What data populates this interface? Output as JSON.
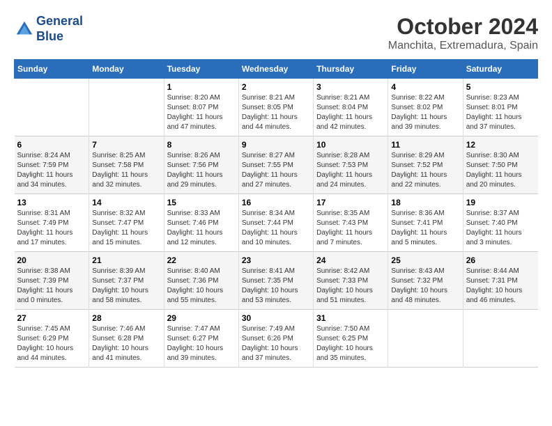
{
  "header": {
    "logo_line1": "General",
    "logo_line2": "Blue",
    "title": "October 2024",
    "subtitle": "Manchita, Extremadura, Spain"
  },
  "calendar": {
    "headers": [
      "Sunday",
      "Monday",
      "Tuesday",
      "Wednesday",
      "Thursday",
      "Friday",
      "Saturday"
    ],
    "weeks": [
      [
        {
          "day": "",
          "info": ""
        },
        {
          "day": "",
          "info": ""
        },
        {
          "day": "1",
          "info": "Sunrise: 8:20 AM\nSunset: 8:07 PM\nDaylight: 11 hours and 47 minutes."
        },
        {
          "day": "2",
          "info": "Sunrise: 8:21 AM\nSunset: 8:05 PM\nDaylight: 11 hours and 44 minutes."
        },
        {
          "day": "3",
          "info": "Sunrise: 8:21 AM\nSunset: 8:04 PM\nDaylight: 11 hours and 42 minutes."
        },
        {
          "day": "4",
          "info": "Sunrise: 8:22 AM\nSunset: 8:02 PM\nDaylight: 11 hours and 39 minutes."
        },
        {
          "day": "5",
          "info": "Sunrise: 8:23 AM\nSunset: 8:01 PM\nDaylight: 11 hours and 37 minutes."
        }
      ],
      [
        {
          "day": "6",
          "info": "Sunrise: 8:24 AM\nSunset: 7:59 PM\nDaylight: 11 hours and 34 minutes."
        },
        {
          "day": "7",
          "info": "Sunrise: 8:25 AM\nSunset: 7:58 PM\nDaylight: 11 hours and 32 minutes."
        },
        {
          "day": "8",
          "info": "Sunrise: 8:26 AM\nSunset: 7:56 PM\nDaylight: 11 hours and 29 minutes."
        },
        {
          "day": "9",
          "info": "Sunrise: 8:27 AM\nSunset: 7:55 PM\nDaylight: 11 hours and 27 minutes."
        },
        {
          "day": "10",
          "info": "Sunrise: 8:28 AM\nSunset: 7:53 PM\nDaylight: 11 hours and 24 minutes."
        },
        {
          "day": "11",
          "info": "Sunrise: 8:29 AM\nSunset: 7:52 PM\nDaylight: 11 hours and 22 minutes."
        },
        {
          "day": "12",
          "info": "Sunrise: 8:30 AM\nSunset: 7:50 PM\nDaylight: 11 hours and 20 minutes."
        }
      ],
      [
        {
          "day": "13",
          "info": "Sunrise: 8:31 AM\nSunset: 7:49 PM\nDaylight: 11 hours and 17 minutes."
        },
        {
          "day": "14",
          "info": "Sunrise: 8:32 AM\nSunset: 7:47 PM\nDaylight: 11 hours and 15 minutes."
        },
        {
          "day": "15",
          "info": "Sunrise: 8:33 AM\nSunset: 7:46 PM\nDaylight: 11 hours and 12 minutes."
        },
        {
          "day": "16",
          "info": "Sunrise: 8:34 AM\nSunset: 7:44 PM\nDaylight: 11 hours and 10 minutes."
        },
        {
          "day": "17",
          "info": "Sunrise: 8:35 AM\nSunset: 7:43 PM\nDaylight: 11 hours and 7 minutes."
        },
        {
          "day": "18",
          "info": "Sunrise: 8:36 AM\nSunset: 7:41 PM\nDaylight: 11 hours and 5 minutes."
        },
        {
          "day": "19",
          "info": "Sunrise: 8:37 AM\nSunset: 7:40 PM\nDaylight: 11 hours and 3 minutes."
        }
      ],
      [
        {
          "day": "20",
          "info": "Sunrise: 8:38 AM\nSunset: 7:39 PM\nDaylight: 11 hours and 0 minutes."
        },
        {
          "day": "21",
          "info": "Sunrise: 8:39 AM\nSunset: 7:37 PM\nDaylight: 10 hours and 58 minutes."
        },
        {
          "day": "22",
          "info": "Sunrise: 8:40 AM\nSunset: 7:36 PM\nDaylight: 10 hours and 55 minutes."
        },
        {
          "day": "23",
          "info": "Sunrise: 8:41 AM\nSunset: 7:35 PM\nDaylight: 10 hours and 53 minutes."
        },
        {
          "day": "24",
          "info": "Sunrise: 8:42 AM\nSunset: 7:33 PM\nDaylight: 10 hours and 51 minutes."
        },
        {
          "day": "25",
          "info": "Sunrise: 8:43 AM\nSunset: 7:32 PM\nDaylight: 10 hours and 48 minutes."
        },
        {
          "day": "26",
          "info": "Sunrise: 8:44 AM\nSunset: 7:31 PM\nDaylight: 10 hours and 46 minutes."
        }
      ],
      [
        {
          "day": "27",
          "info": "Sunrise: 7:45 AM\nSunset: 6:29 PM\nDaylight: 10 hours and 44 minutes."
        },
        {
          "day": "28",
          "info": "Sunrise: 7:46 AM\nSunset: 6:28 PM\nDaylight: 10 hours and 41 minutes."
        },
        {
          "day": "29",
          "info": "Sunrise: 7:47 AM\nSunset: 6:27 PM\nDaylight: 10 hours and 39 minutes."
        },
        {
          "day": "30",
          "info": "Sunrise: 7:49 AM\nSunset: 6:26 PM\nDaylight: 10 hours and 37 minutes."
        },
        {
          "day": "31",
          "info": "Sunrise: 7:50 AM\nSunset: 6:25 PM\nDaylight: 10 hours and 35 minutes."
        },
        {
          "day": "",
          "info": ""
        },
        {
          "day": "",
          "info": ""
        }
      ]
    ]
  }
}
